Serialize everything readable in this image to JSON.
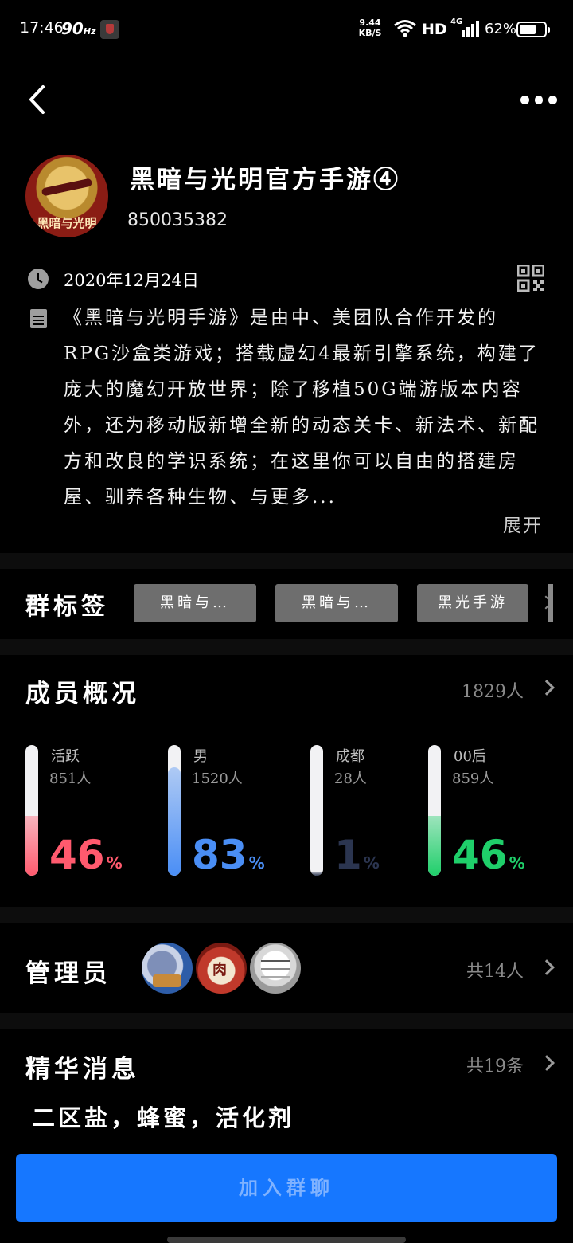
{
  "status_bar": {
    "time": "17:46",
    "refresh": "90",
    "refresh_unit": "Hz",
    "net_speed": "9.44",
    "net_unit": "KB/S",
    "hd": "HD",
    "network": "4G",
    "battery": "62%"
  },
  "group": {
    "name": "黑暗与光明官方手游④",
    "id": "850035382",
    "avatar_text": "黑暗与光明",
    "date": "2020年12月24日",
    "description": "《黑暗与光明手游》是由中、美团队合作开发的RPG沙盒类游戏；搭载虚幻4最新引擎系统，构建了庞大的魔幻开放世界；除了移植50G端游版本内容外，还为移动版新增全新的动态关卡、新法术、新配方和改良的学识系统；在这里你可以自由的搭建房屋、驯养各种生物、与更多...",
    "expand": "展开"
  },
  "tags": {
    "title": "群标签",
    "items": [
      "黑暗与…",
      "黑暗与…",
      "黑光手游"
    ]
  },
  "members": {
    "title": "成员概况",
    "total": "1829人",
    "stats": [
      {
        "label": "活跃",
        "count": "851人",
        "percent": 46,
        "color": "#ff5a6e"
      },
      {
        "label": "男",
        "count": "1520人",
        "percent": 83,
        "color": "#4a8ef5"
      },
      {
        "label": "成都",
        "count": "28人",
        "percent": 1,
        "color": "#2b3550"
      },
      {
        "label": "00后",
        "count": "859人",
        "percent": 46,
        "color": "#1fcf6a"
      }
    ]
  },
  "admins": {
    "title": "管理员",
    "total": "共14人"
  },
  "essence": {
    "title": "精华消息",
    "total": "共19条",
    "latest": "二区盐，蜂蜜，活化剂"
  },
  "join_button": "加入群聊"
}
